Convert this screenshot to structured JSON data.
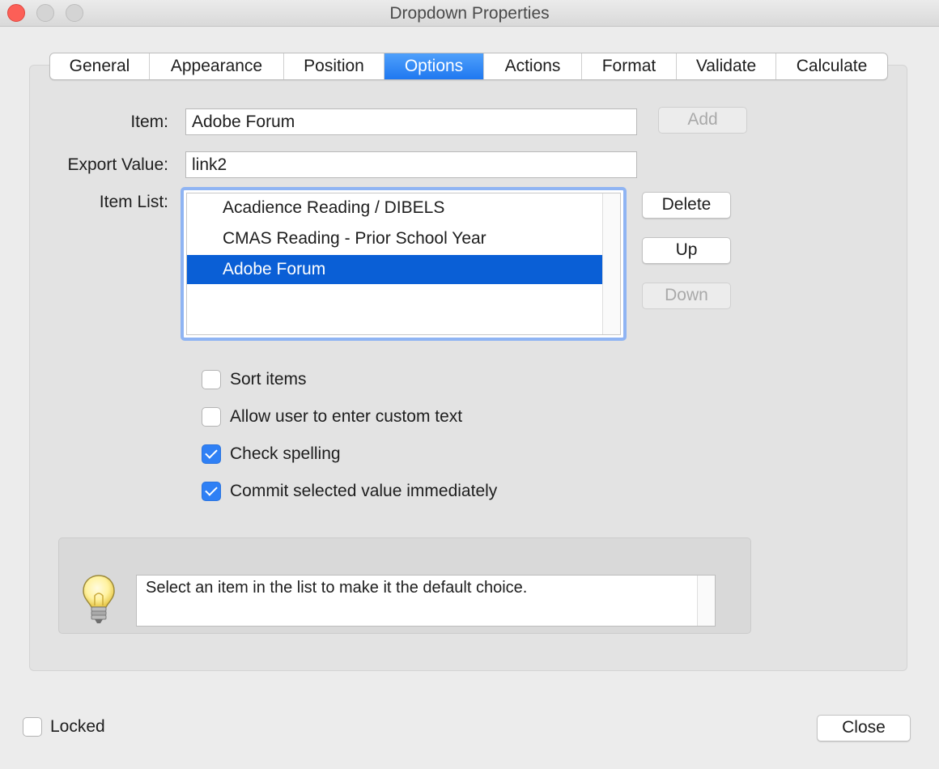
{
  "window": {
    "title": "Dropdown Properties"
  },
  "tabs": [
    {
      "label": "General",
      "active": false
    },
    {
      "label": "Appearance",
      "active": false
    },
    {
      "label": "Position",
      "active": false
    },
    {
      "label": "Options",
      "active": true
    },
    {
      "label": "Actions",
      "active": false
    },
    {
      "label": "Format",
      "active": false
    },
    {
      "label": "Validate",
      "active": false
    },
    {
      "label": "Calculate",
      "active": false
    }
  ],
  "options": {
    "item_label": "Item:",
    "item_value": "Adobe Forum",
    "export_label": "Export Value:",
    "export_value": "link2",
    "item_list_label": "Item List:",
    "item_list": [
      {
        "text": "Acadience Reading / DIBELS",
        "selected": false
      },
      {
        "text": "CMAS Reading - Prior School Year",
        "selected": false
      },
      {
        "text": "Adobe Forum",
        "selected": true
      }
    ],
    "buttons": {
      "add": "Add",
      "delete": "Delete",
      "up": "Up",
      "down": "Down"
    },
    "checkboxes": [
      {
        "label": "Sort items",
        "checked": false
      },
      {
        "label": "Allow user to enter custom text",
        "checked": false
      },
      {
        "label": "Check spelling",
        "checked": true
      },
      {
        "label": "Commit selected value immediately",
        "checked": true
      }
    ],
    "hint": "Select an item in the list to make it the default choice."
  },
  "footer": {
    "locked_label": "Locked",
    "locked_checked": false,
    "close_label": "Close"
  },
  "colors": {
    "accent": "#1f78f0",
    "selection": "#0a5fd6"
  }
}
